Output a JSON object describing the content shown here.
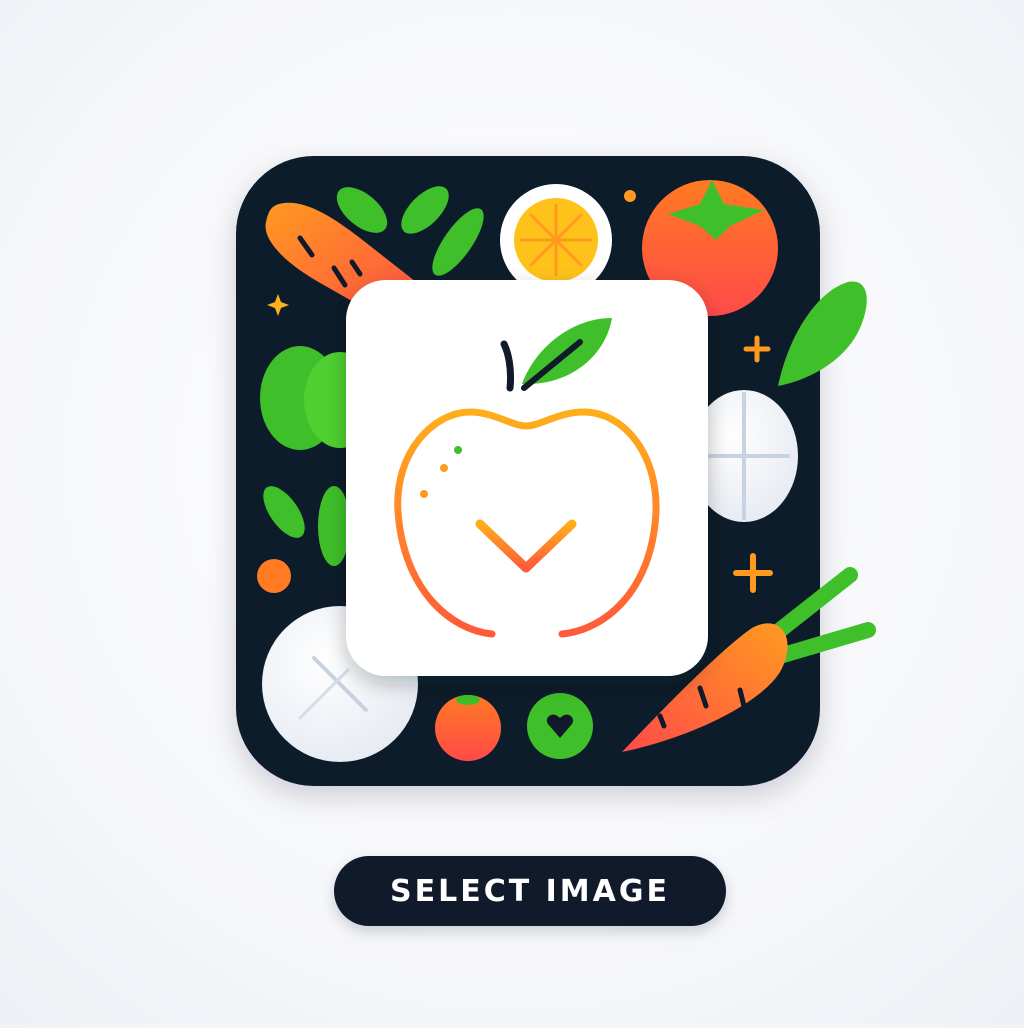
{
  "app": {
    "icon": "food-tray-app-icon",
    "center_icon": "apple-check-icon"
  },
  "actions": {
    "select_image_label": "SELECT IMAGE"
  },
  "colors": {
    "tray": "#101a2b",
    "accent_orange": "#ff9a1f",
    "accent_green": "#3fbf2a",
    "tomato": "#ff5a2a",
    "card": "#ffffff"
  }
}
